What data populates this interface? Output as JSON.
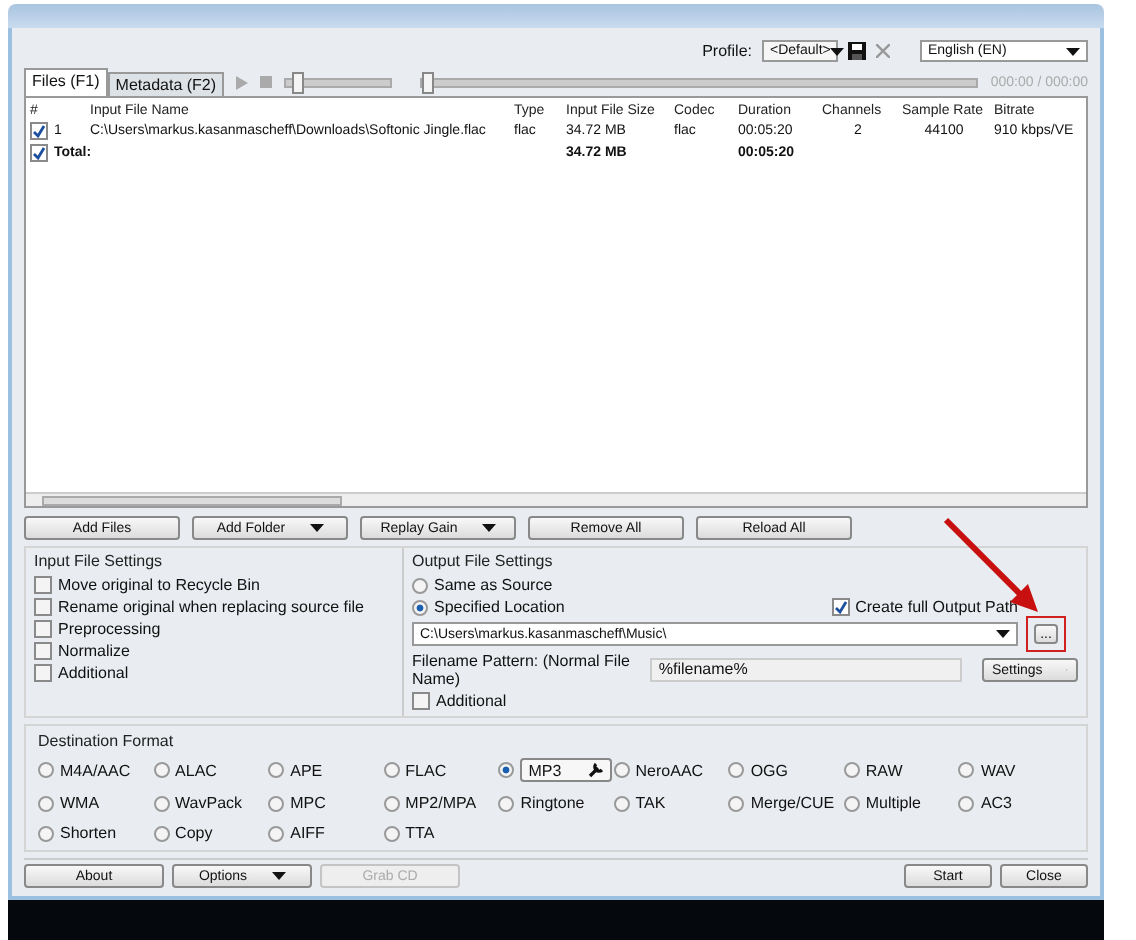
{
  "toolbar": {
    "profile_label": "Profile:",
    "profile_value": "<Default>",
    "language": "English (EN)"
  },
  "tabs": [
    {
      "label": "Files (F1)",
      "selected": true
    },
    {
      "label": "Metadata (F2)",
      "selected": false
    }
  ],
  "player": {
    "volume": {
      "level": 0.05
    },
    "seek": {
      "level": 0.0
    },
    "time": "000:00 / 000:00"
  },
  "table": {
    "columns": [
      "#",
      "Input File Name",
      "Type",
      "Input File Size",
      "Codec",
      "Duration",
      "Channels",
      "Sample Rate",
      "Bitrate"
    ],
    "rows": [
      {
        "checked": true,
        "cells": [
          "1",
          "C:\\Users\\markus.kasanmascheff\\Downloads\\Softonic Jingle.flac",
          "flac",
          "34.72 MB",
          "flac",
          "00:05:20",
          "2",
          "44100",
          "910 kbps/VE"
        ]
      }
    ],
    "total": {
      "checked": true,
      "label": "Total:",
      "size": "34.72 MB",
      "duration": "00:05:20"
    }
  },
  "actions": [
    {
      "label": "Add Files",
      "dropdown": false
    },
    {
      "label": "Add Folder",
      "dropdown": true
    },
    {
      "label": "Replay Gain",
      "dropdown": true
    },
    {
      "label": "Remove All",
      "dropdown": false
    },
    {
      "label": "Reload All",
      "dropdown": false
    }
  ],
  "input_settings": {
    "title": "Input File Settings",
    "options": [
      {
        "label": "Move original to Recycle Bin",
        "checked": false
      },
      {
        "label": "Rename original when replacing source file",
        "checked": false
      },
      {
        "label": "Preprocessing",
        "checked": false
      },
      {
        "label": "Normalize",
        "checked": false
      },
      {
        "label": "Additional",
        "checked": false
      }
    ]
  },
  "output_settings": {
    "title": "Output File Settings",
    "locations": [
      {
        "label": "Same as Source",
        "selected": false
      },
      {
        "label": "Specified Location",
        "selected": true
      }
    ],
    "full_path": {
      "label": "Create full Output Path",
      "checked": true
    },
    "path": "C:\\Users\\markus.kasanmascheff\\Music\\",
    "browse": "...",
    "pattern_label": "Filename Pattern: (Normal File Name)",
    "pattern": "%filename%",
    "settings": "Settings",
    "additional": {
      "label": "Additional",
      "checked": false
    }
  },
  "destination": {
    "title": "Destination Format",
    "formats": [
      {
        "label": "M4A/AAC",
        "selected": false
      },
      {
        "label": "ALAC",
        "selected": false
      },
      {
        "label": "APE",
        "selected": false
      },
      {
        "label": "FLAC",
        "selected": false
      },
      {
        "label": "MP3",
        "selected": true
      },
      {
        "label": "NeroAAC",
        "selected": false
      },
      {
        "label": "OGG",
        "selected": false
      },
      {
        "label": "RAW",
        "selected": false
      },
      {
        "label": "WAV",
        "selected": false
      },
      {
        "label": "WMA",
        "selected": false
      },
      {
        "label": "WavPack",
        "selected": false
      },
      {
        "label": "MPC",
        "selected": false
      },
      {
        "label": "MP2/MPA",
        "selected": false
      },
      {
        "label": "Ringtone",
        "selected": false
      },
      {
        "label": "TAK",
        "selected": false
      },
      {
        "label": "Merge/CUE",
        "selected": false
      },
      {
        "label": "Multiple",
        "selected": false
      },
      {
        "label": "AC3",
        "selected": false
      },
      {
        "label": "Shorten",
        "selected": false
      },
      {
        "label": "Copy",
        "selected": false
      },
      {
        "label": "AIFF",
        "selected": false
      },
      {
        "label": "TTA",
        "selected": false
      }
    ]
  },
  "footer_left": [
    {
      "label": "About",
      "dropdown": false,
      "disabled": false
    },
    {
      "label": "Options",
      "dropdown": true,
      "disabled": false
    },
    {
      "label": "Grab CD",
      "dropdown": false,
      "disabled": true
    }
  ],
  "footer_right": [
    {
      "label": "Start",
      "dropdown": false,
      "disabled": false
    },
    {
      "label": "Close",
      "dropdown": false,
      "disabled": false
    }
  ]
}
